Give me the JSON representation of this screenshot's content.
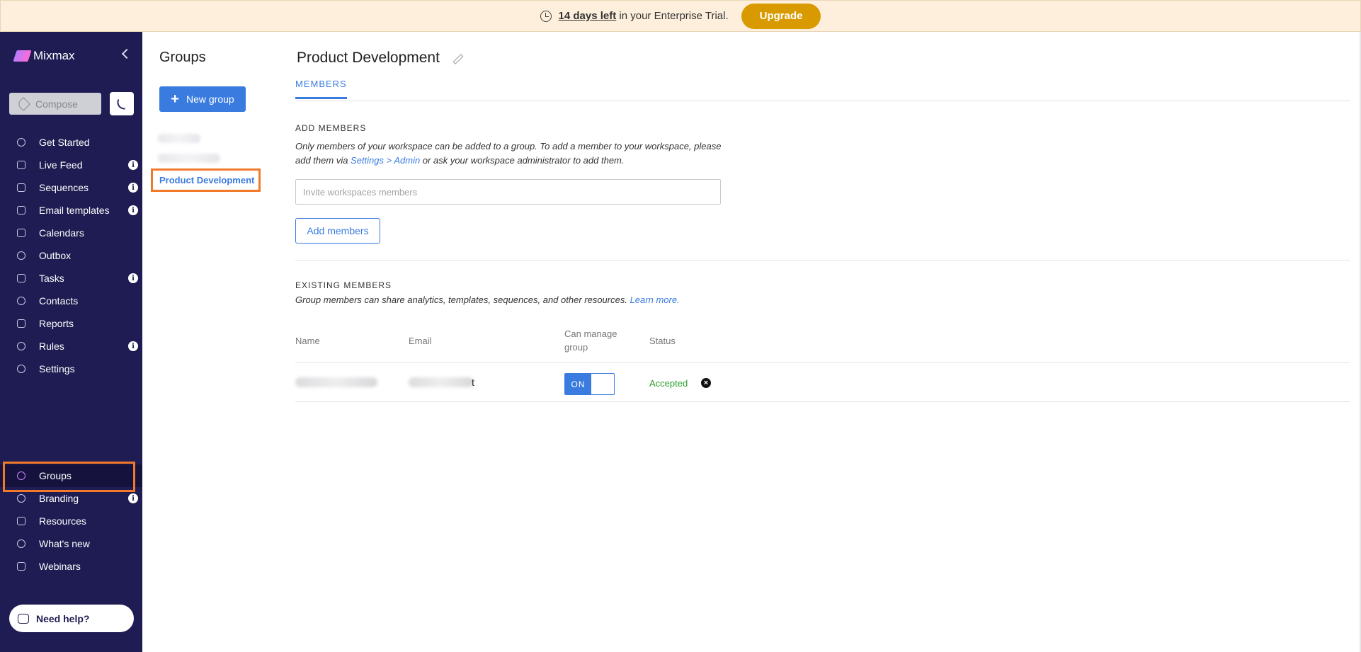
{
  "banner": {
    "days_left": "14 days left",
    "trial_text": "in your Enterprise Trial.",
    "upgrade_label": "Upgrade"
  },
  "sidebar": {
    "brand": "Mixmax",
    "compose_label": "Compose",
    "items": [
      {
        "label": "Get Started",
        "icon": "rocket-icon",
        "info": false
      },
      {
        "label": "Live Feed",
        "icon": "bolt-icon",
        "info": true
      },
      {
        "label": "Sequences",
        "icon": "layers-icon",
        "info": true
      },
      {
        "label": "Email templates",
        "icon": "templates-icon",
        "info": true
      },
      {
        "label": "Calendars",
        "icon": "calendar-icon",
        "info": false
      },
      {
        "label": "Outbox",
        "icon": "outbox-icon",
        "info": false
      },
      {
        "label": "Tasks",
        "icon": "clipboard-icon",
        "info": true
      },
      {
        "label": "Contacts",
        "icon": "person-icon",
        "info": false
      },
      {
        "label": "Reports",
        "icon": "bar-chart-icon",
        "info": false
      },
      {
        "label": "Rules",
        "icon": "branch-icon",
        "info": true
      },
      {
        "label": "Settings",
        "icon": "gear-icon",
        "info": false
      }
    ],
    "bottom_items": [
      {
        "label": "Groups",
        "icon": "groups-icon",
        "info": false,
        "active": true
      },
      {
        "label": "Branding",
        "icon": "copyright-icon",
        "info": true
      },
      {
        "label": "Resources",
        "icon": "book-icon",
        "info": false
      },
      {
        "label": "What's new",
        "icon": "bell-icon",
        "info": false
      },
      {
        "label": "Webinars",
        "icon": "graduation-cap-icon",
        "info": false
      }
    ],
    "info_glyph": "i",
    "help_label": "Need help?"
  },
  "groups": {
    "title": "Groups",
    "new_group_label": "New group",
    "plus": "+",
    "selected": "Product Development"
  },
  "main": {
    "title": "Product Development",
    "tab": "MEMBERS",
    "add_members": {
      "heading": "ADD MEMBERS",
      "desc_1": "Only members of your workspace can be added to a group. To add a member to your workspace, please",
      "desc_2_pre": "add them via ",
      "desc_2_link": "Settings > Admin",
      "desc_2_post": " or ask your workspace administrator to add them.",
      "input_placeholder": "Invite workspaces members",
      "button_label": "Add members"
    },
    "existing": {
      "heading": "EXISTING MEMBERS",
      "desc_pre": "Group members can share analytics, templates, sequences, and other resources. ",
      "desc_link": "Learn more.",
      "columns": [
        "Name",
        "Email",
        "Can manage group",
        "Status"
      ],
      "row": {
        "email_tail": "t",
        "toggle": "ON",
        "status": "Accepted",
        "remove_glyph": "×"
      }
    }
  },
  "colors": {
    "sidebar_bg": "#1e1c52",
    "accent": "#3a7be0",
    "upgrade": "#d99a00",
    "highlight": "#f07a2a",
    "accepted": "#2a9d2a"
  }
}
